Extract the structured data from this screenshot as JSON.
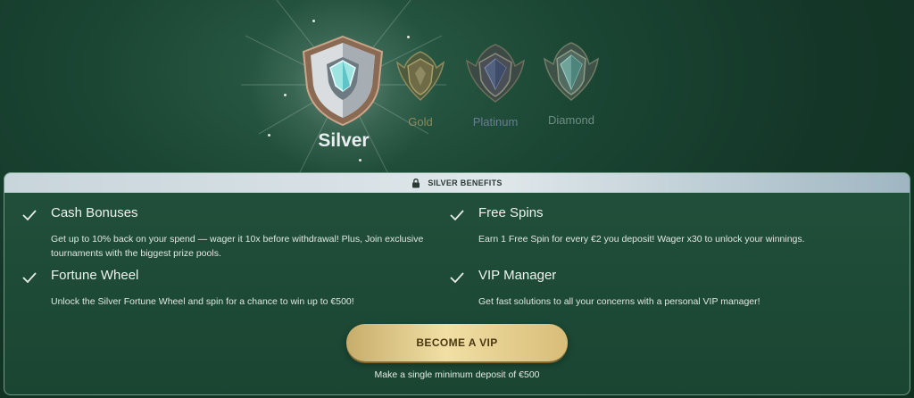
{
  "tiers": [
    {
      "name": "Silver",
      "icon": "silver-shield-icon",
      "active": true,
      "color": "#e9eef0"
    },
    {
      "name": "Gold",
      "icon": "gold-badge-icon",
      "active": false,
      "color": "#8e8a5c"
    },
    {
      "name": "Platinum",
      "icon": "platinum-badge-icon",
      "active": false,
      "color": "#6b7c93"
    },
    {
      "name": "Diamond",
      "icon": "diamond-badge-icon",
      "active": false,
      "color": "#6f8d83"
    }
  ],
  "panel": {
    "header": "SILVER BENEFITS",
    "header_icon": "lock-icon",
    "benefits": [
      {
        "title": "Cash Bonuses",
        "desc": "Get up to 10% back on your spend — wager it 10x before withdrawal! Plus, Join exclusive tournaments with the biggest prize pools."
      },
      {
        "title": "Free Spins",
        "desc": "Earn 1 Free Spin for every €2 you deposit! Wager x30 to unlock your winnings."
      },
      {
        "title": "Fortune Wheel",
        "desc": "Unlock the Silver Fortune Wheel and spin for a chance to win up to €500!"
      },
      {
        "title": "VIP Manager",
        "desc": "Get fast solutions to all your concerns with a personal VIP manager!"
      }
    ],
    "benefit_icon": "checkmark-icon"
  },
  "cta": {
    "label": "BECOME A VIP",
    "note": "Make a single minimum deposit of €500"
  },
  "colors": {
    "background": "#143628",
    "panel": "#1d4a36",
    "accent_gold": "#e9d396",
    "header_bar": "#d6e0e4"
  }
}
